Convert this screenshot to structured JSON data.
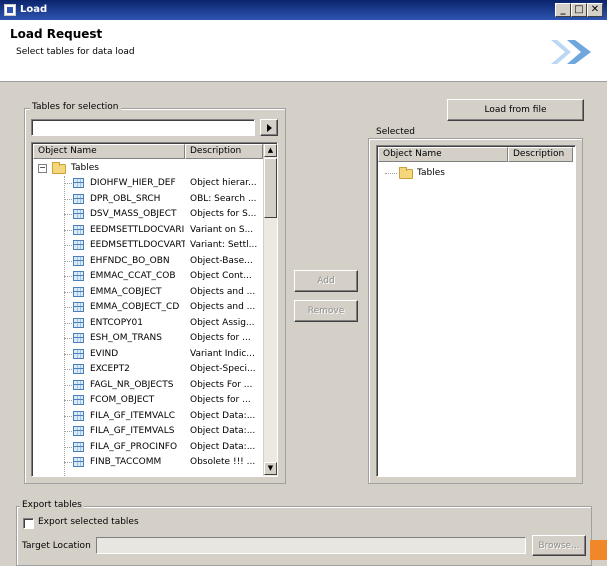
{
  "window": {
    "title": "Load"
  },
  "header": {
    "title": "Load Request",
    "subtitle": "Select tables for data load"
  },
  "left_group": {
    "legend": "Tables for selection",
    "search_value": "",
    "columns": [
      "Object Name",
      "Description"
    ],
    "root_label": "Tables",
    "rows": [
      {
        "name": "DIOHFW_HIER_DEF",
        "desc": "Object hierar..."
      },
      {
        "name": "DPR_OBL_SRCH",
        "desc": "OBL: Search ..."
      },
      {
        "name": "DSV_MASS_OBJECT",
        "desc": "Objects for S..."
      },
      {
        "name": "EEDMSETTLDOCVARI",
        "desc": "Variant on S..."
      },
      {
        "name": "EEDMSETTLDOCVART",
        "desc": "Variant: Settl..."
      },
      {
        "name": "EHFNDC_BO_OBN",
        "desc": "Object-Base..."
      },
      {
        "name": "EMMAC_CCAT_COB",
        "desc": "Object Cont..."
      },
      {
        "name": "EMMA_COBJECT",
        "desc": "Objects and ..."
      },
      {
        "name": "EMMA_COBJECT_CD",
        "desc": "Objects and ..."
      },
      {
        "name": "ENTCOPY01",
        "desc": "Object Assig..."
      },
      {
        "name": "ESH_OM_TRANS",
        "desc": "Objects for ..."
      },
      {
        "name": "EVIND",
        "desc": "Variant Indic..."
      },
      {
        "name": "EXCEPT2",
        "desc": "Object-Speci..."
      },
      {
        "name": "FAGL_NR_OBJECTS",
        "desc": "Objects For ..."
      },
      {
        "name": "FCOM_OBJECT",
        "desc": "Objects for ..."
      },
      {
        "name": "FILA_GF_ITEMVALC",
        "desc": "Object Data:..."
      },
      {
        "name": "FILA_GF_ITEMVALS",
        "desc": "Object Data:..."
      },
      {
        "name": "FILA_GF_PROCINFO",
        "desc": "Object Data:..."
      },
      {
        "name": "FINB_TACCOMM",
        "desc": "Obsolete !!! ..."
      }
    ]
  },
  "middle": {
    "add_label": "Add",
    "remove_label": "Remove"
  },
  "right_group": {
    "load_button": "Load from file",
    "legend": "Selected",
    "columns": [
      "Object Name",
      "Description"
    ],
    "root_label": "Tables"
  },
  "export_group": {
    "legend": "Export tables",
    "checkbox_label": "Export selected tables",
    "target_label": "Target Location",
    "target_value": "",
    "browse_label": "Browse..."
  },
  "colors": {
    "titlebar": "#0a246a",
    "accent_arrows": "#7fb2e5"
  },
  "icons": [
    "table-icon",
    "folder-icon",
    "collapse-icon",
    "arrow-right-icon",
    "scroll-up-icon",
    "scroll-down-icon",
    "minimize-icon",
    "maximize-icon",
    "close-icon"
  ]
}
